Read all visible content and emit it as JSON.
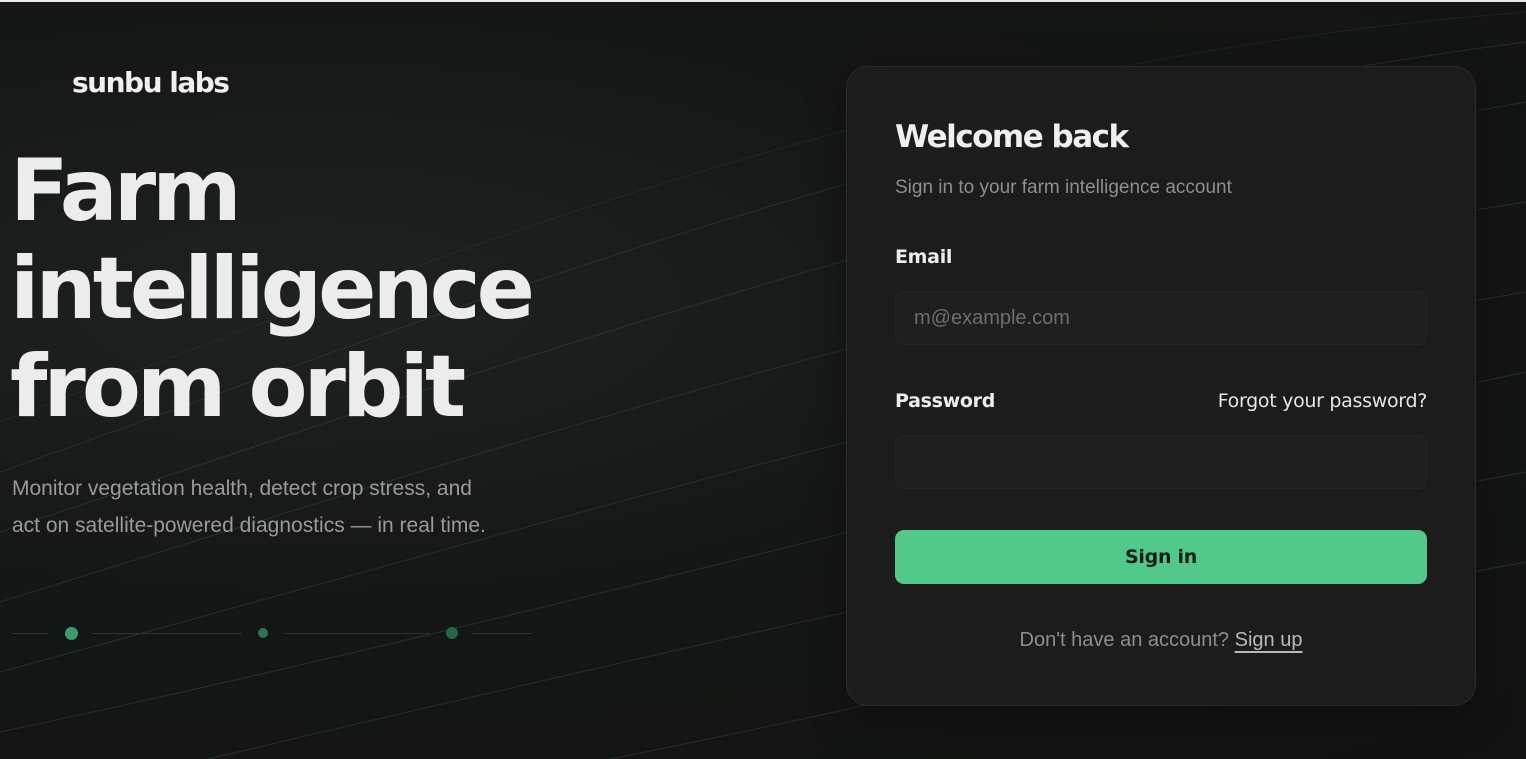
{
  "brand": {
    "name": "sunbu labs"
  },
  "hero": {
    "title_lines": [
      "Farm",
      "intelligence",
      "from orbit"
    ],
    "subtitle_line1": "Monitor vegetation health, detect crop stress, and",
    "subtitle_line2": "act on satellite-powered diagnostics — in real time."
  },
  "login": {
    "title": "Welcome back",
    "subtitle": "Sign in to your farm intelligence account",
    "email_label": "Email",
    "email_placeholder": "m@example.com",
    "email_value": "",
    "password_label": "Password",
    "password_value": "",
    "forgot_label": "Forgot your password?",
    "submit_label": "Sign in",
    "signup_prompt": "Don't have an account?",
    "signup_link": "Sign up"
  },
  "colors": {
    "background": "#131414",
    "card": "#1c1c1c",
    "accent": "#52c98b",
    "muted_text": "#8e8e8e"
  }
}
